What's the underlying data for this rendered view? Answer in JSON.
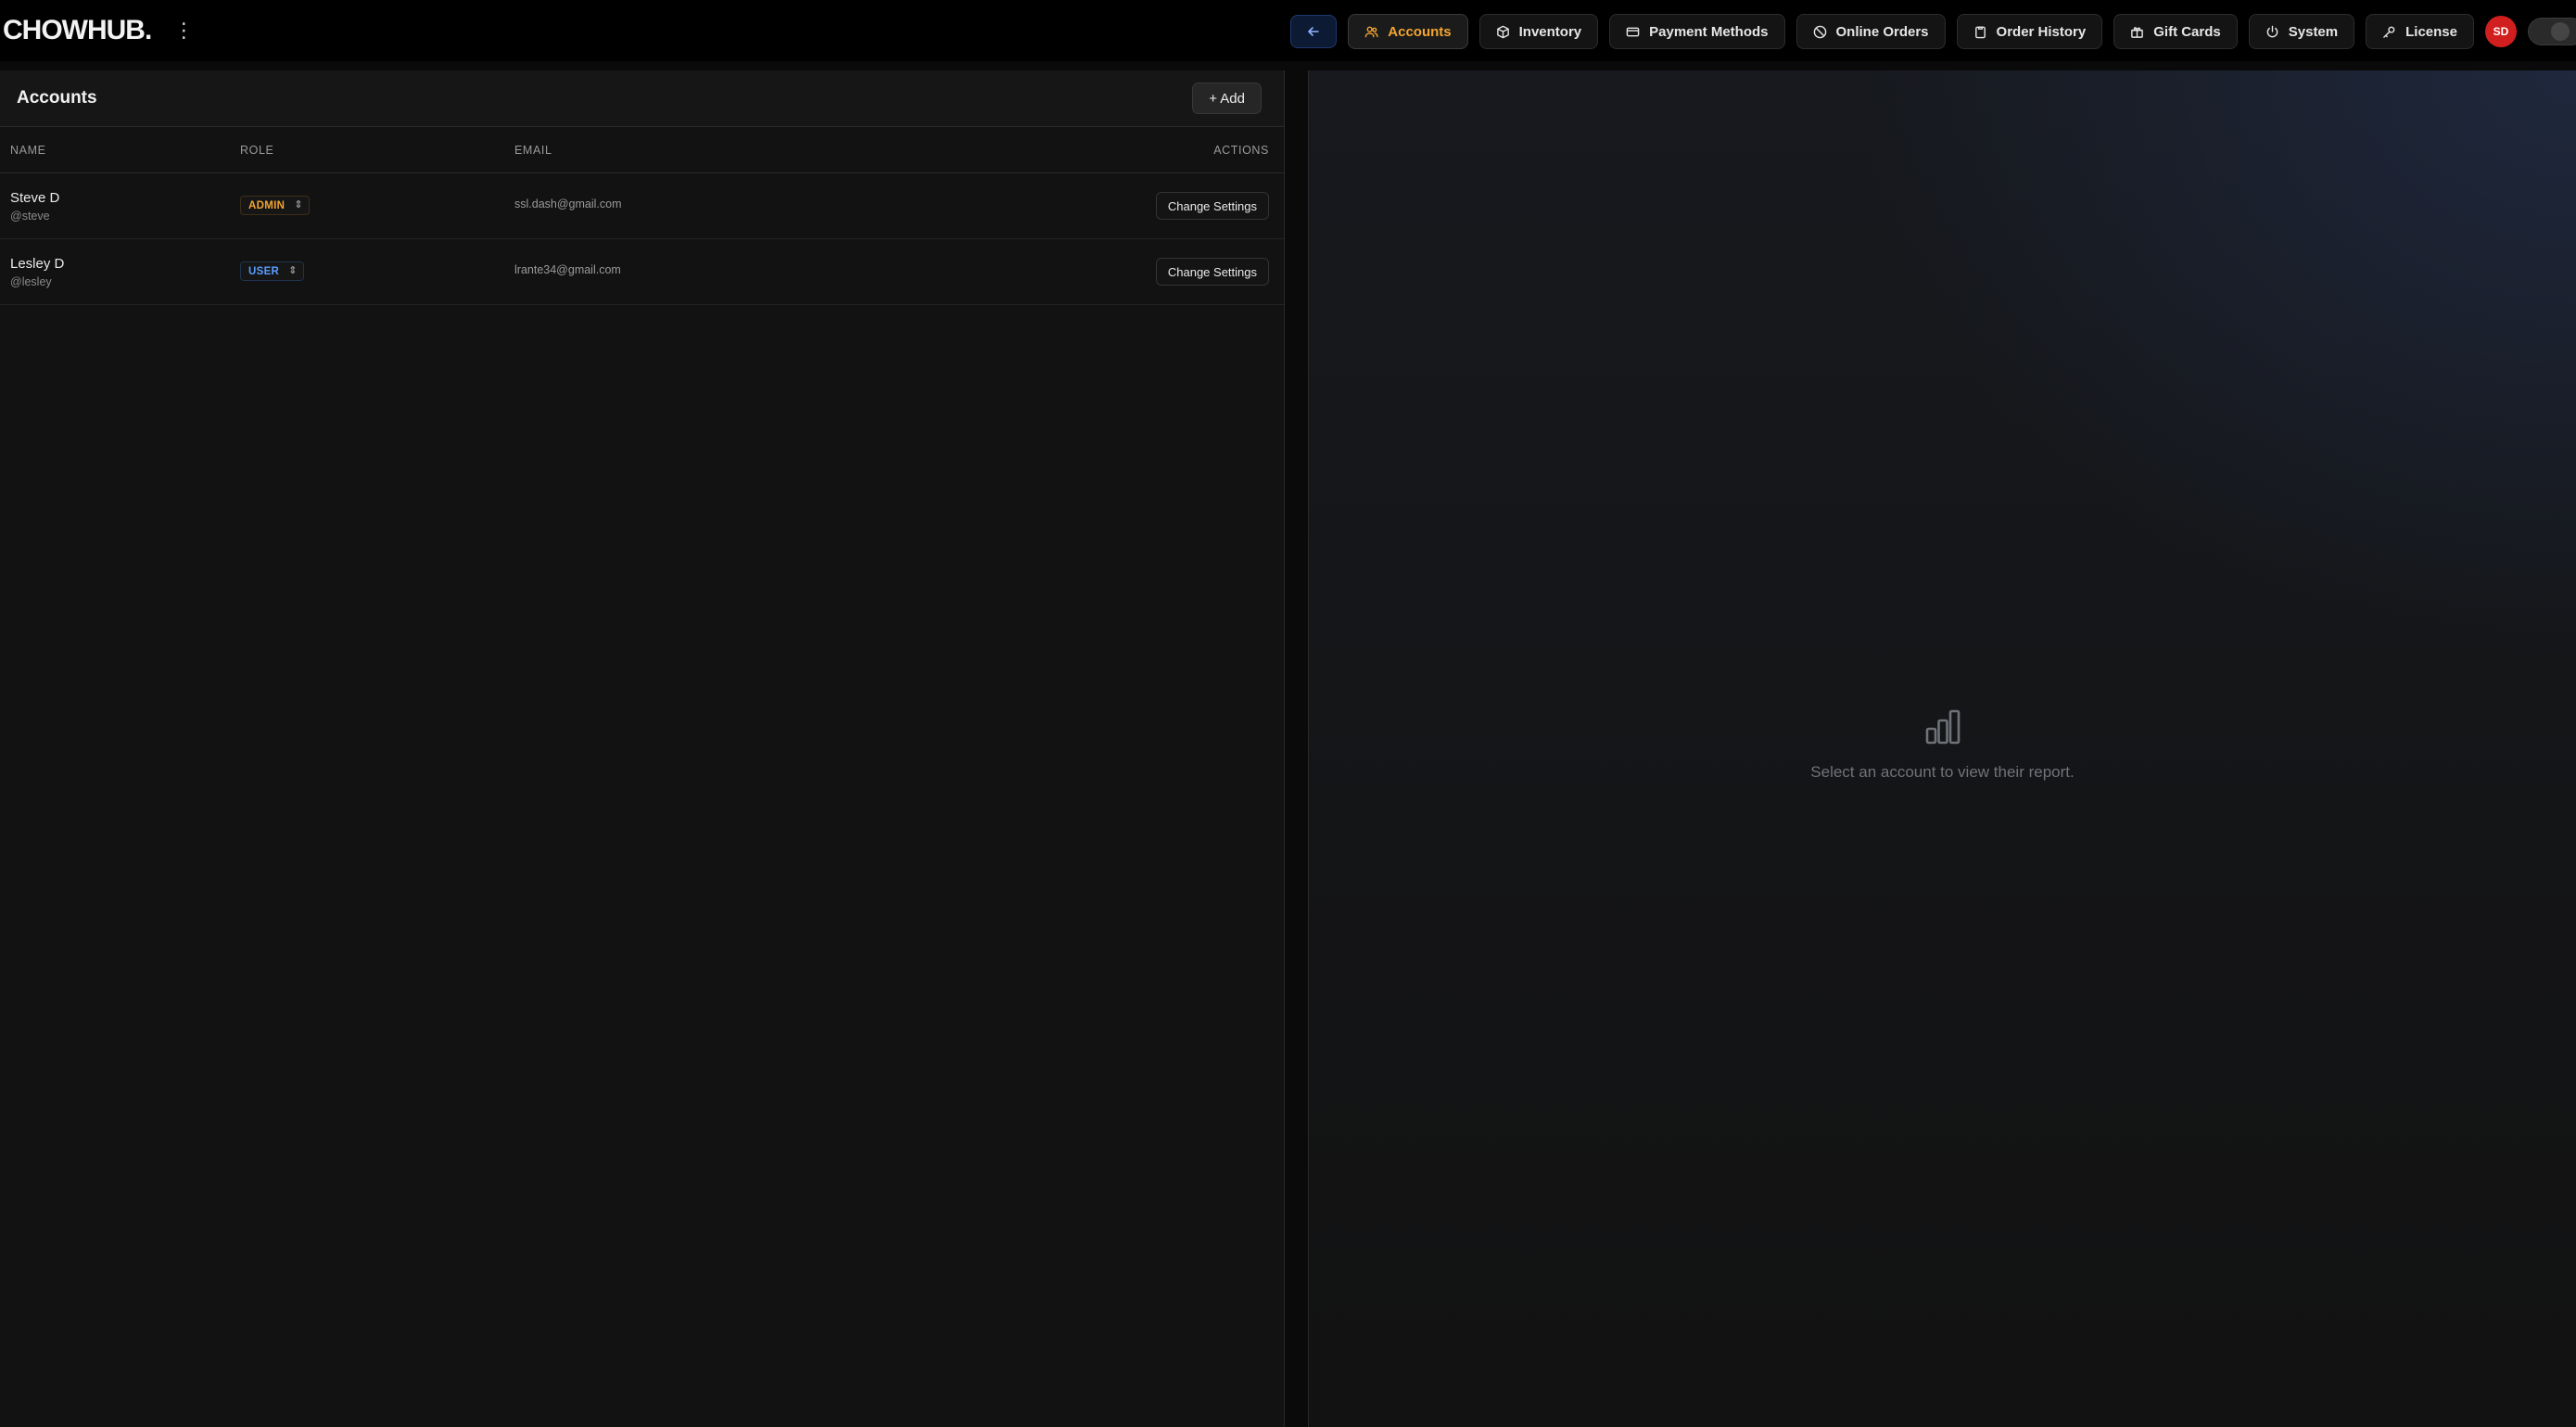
{
  "brand": "CHOWHUB.",
  "nav": {
    "back_icon": "arrow-left-icon",
    "items": [
      {
        "label": "Accounts",
        "icon": "users-icon",
        "active": true
      },
      {
        "label": "Inventory",
        "icon": "box-icon",
        "active": false
      },
      {
        "label": "Payment Methods",
        "icon": "credit-card-icon",
        "active": false
      },
      {
        "label": "Online Orders",
        "icon": "globe-icon",
        "active": false
      },
      {
        "label": "Order History",
        "icon": "clipboard-icon",
        "active": false
      },
      {
        "label": "Gift Cards",
        "icon": "gift-icon",
        "active": false
      },
      {
        "label": "System",
        "icon": "power-icon",
        "active": false
      },
      {
        "label": "License",
        "icon": "key-icon",
        "active": false
      }
    ],
    "avatar_initials": "SD"
  },
  "accounts": {
    "title": "Accounts",
    "add_label": "+ Add",
    "columns": {
      "name": "NAME",
      "role": "ROLE",
      "email": "EMAIL",
      "actions": "ACTIONS"
    },
    "rows": [
      {
        "name": "Steve D",
        "username": "@steve",
        "role": "ADMIN",
        "email": "ssl.dash@gmail.com",
        "action": "Change Settings"
      },
      {
        "name": "Lesley D",
        "username": "@lesley",
        "role": "USER",
        "email": "lrante34@gmail.com",
        "action": "Change Settings"
      }
    ]
  },
  "report": {
    "empty_icon": "bar-chart-icon",
    "empty_text": "Select an account to view their report."
  },
  "colors": {
    "accent": "#f2a531",
    "user_role": "#5a9cff",
    "avatar": "#d11f1f"
  }
}
